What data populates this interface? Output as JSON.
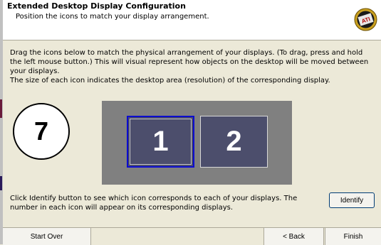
{
  "header": {
    "title": "Extended Desktop Display Configuration",
    "subtitle": "Position the icons to match your display arrangement.",
    "logo_icon": "ati-logo-icon"
  },
  "instructions": {
    "paragraph1": "Drag the icons below to match the physical arrangement of your displays. (To drag, press and hold the left mouse button.) This will visual represent how objects on the desktop will be moved between your displays.",
    "paragraph2": "The size of each icon indicates the desktop area (resolution) of the corresponding display.",
    "paragraph3": "Click Identify button to see which icon corresponds to each of your displays. The number in each icon will appear on its corresponding displays."
  },
  "step_number": "7",
  "displays": [
    {
      "label": "1",
      "selected": true
    },
    {
      "label": "2",
      "selected": false
    }
  ],
  "buttons": {
    "identify": "Identify",
    "start_over": "Start Over",
    "back": "< Back",
    "finish": "Finish"
  },
  "colors": {
    "display_fill": "#4c4e6c",
    "arrangement_bg": "#808080",
    "selected_border": "#0b0bd0",
    "dialog_bg": "#ece9d8"
  }
}
